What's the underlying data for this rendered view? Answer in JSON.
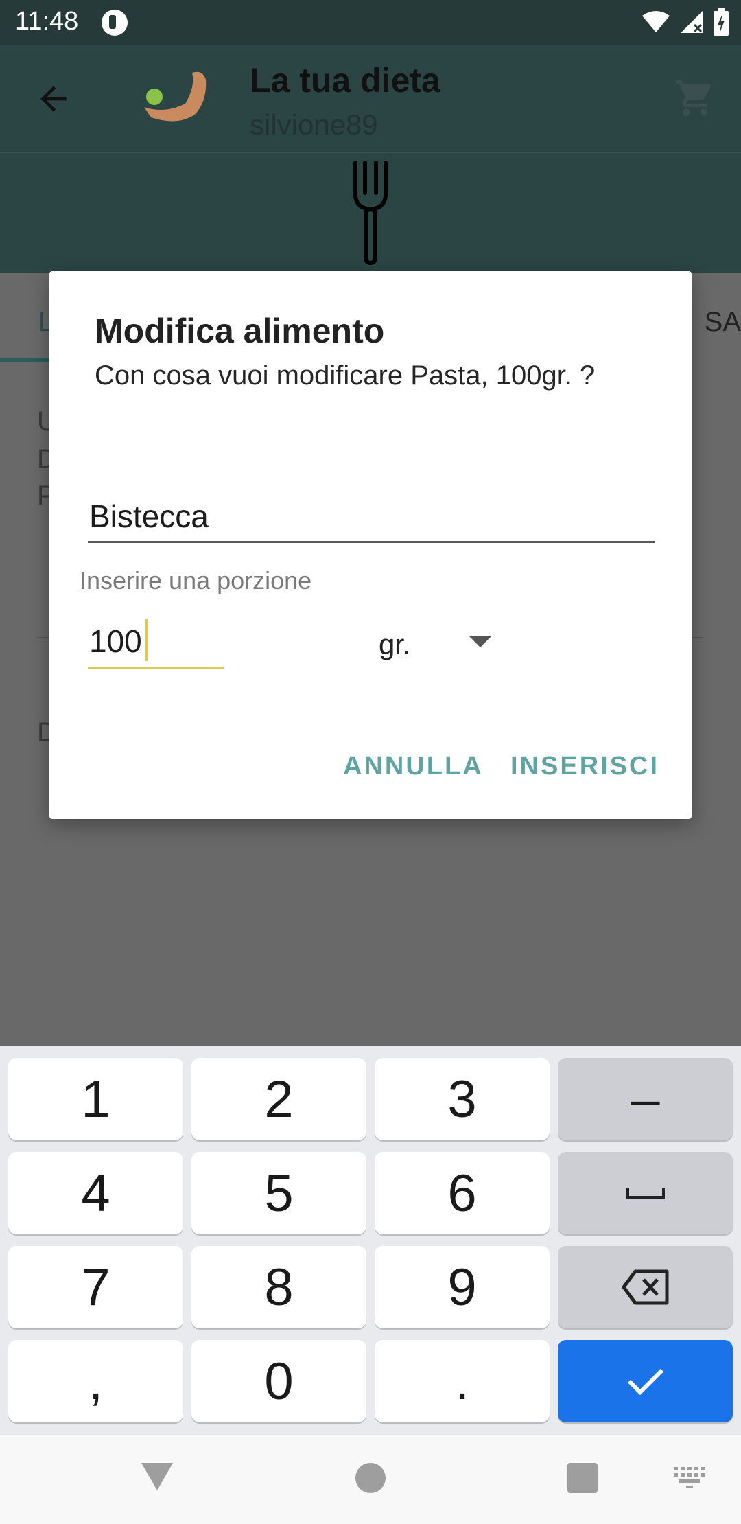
{
  "status_bar": {
    "time": "11:48"
  },
  "app_bar": {
    "title": "La tua dieta",
    "subtitle": "silvione89"
  },
  "background": {
    "tab_left_fragment": "L",
    "tab_right_fragment": "SA",
    "line_fragments": [
      "U",
      "D",
      "P"
    ],
    "lower_fragment": "D"
  },
  "dialog": {
    "title": "Modifica alimento",
    "message": "Con cosa vuoi modificare Pasta, 100gr. ?",
    "food_value": "Bistecca",
    "portion_label": "Inserire una porzione",
    "quantity_value": "100",
    "unit_selected": "gr.",
    "cancel_label": "ANNULLA",
    "insert_label": "INSERISCI"
  },
  "keyboard": {
    "rows": [
      [
        "1",
        "2",
        "3",
        "–"
      ],
      [
        "4",
        "5",
        "6",
        "␣"
      ],
      [
        "7",
        "8",
        "9",
        "⌫"
      ],
      [
        ",",
        "0",
        ".",
        "✓"
      ]
    ]
  },
  "colors": {
    "app_bar": "#2b4545",
    "accent_button": "#5fa3a3",
    "input_focus": "#e2cb4c",
    "keyboard_enter": "#1a73e8"
  }
}
